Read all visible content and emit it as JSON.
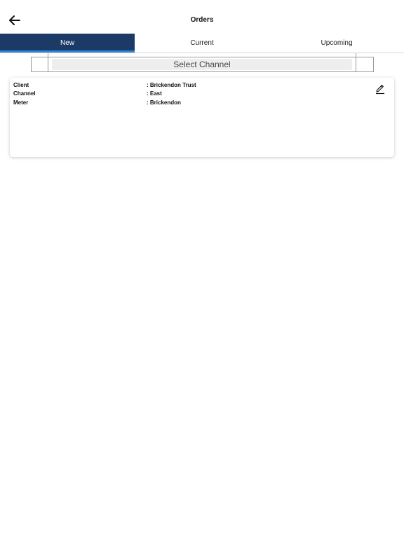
{
  "header": {
    "title": "Orders",
    "back_icon": "arrow-left-icon"
  },
  "tabs": [
    {
      "label": "New",
      "active": true
    },
    {
      "label": "Current",
      "active": false
    },
    {
      "label": "Upcoming",
      "active": false
    }
  ],
  "channel_selector": {
    "label": "Select Channel"
  },
  "colors": {
    "active_tab": "#1b3a66",
    "active_tab_indicator": "#2e86d9"
  },
  "order_card": {
    "fields": [
      {
        "label": "Client",
        "value": ": Brickendon Trust"
      },
      {
        "label": "Channel",
        "value": ": East"
      },
      {
        "label": "Meter",
        "value": ": Brickendon"
      }
    ],
    "edit_icon": "pencil-icon"
  }
}
